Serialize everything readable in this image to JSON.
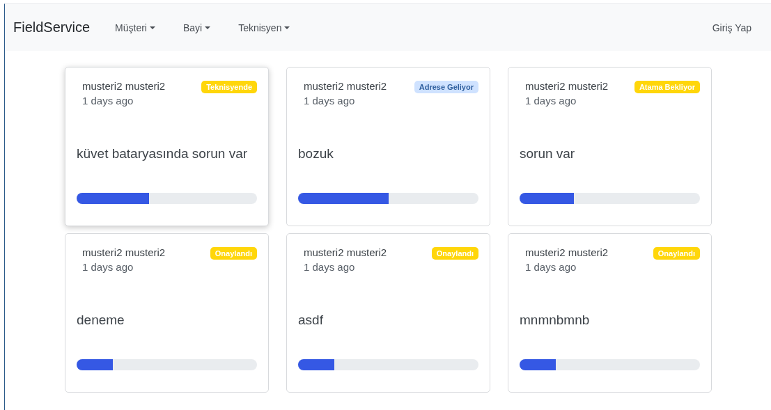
{
  "navbar": {
    "brand": "FieldService",
    "menus": [
      {
        "label": "Müşteri"
      },
      {
        "label": "Bayi"
      },
      {
        "label": "Teknisyen"
      }
    ],
    "login": "Giriş Yap"
  },
  "cards": [
    {
      "customer": "musteri2 musteri2",
      "time": "1 days ago",
      "status": "Teknisyende",
      "color": "#ffd60a",
      "title": "küvet bataryasında sorun var",
      "level": 0.4,
      "highlighted": true
    },
    {
      "customer": "musteri2 musteri2",
      "time": "1 days ago",
      "status": "Adrese Geliyor",
      "color": "#cfe2ff",
      "title": "bozuk",
      "level": 0.5,
      "highlighted": false
    },
    {
      "customer": "musteri2 musteri2",
      "time": "1 days ago",
      "status": "Atama Bekliyor",
      "color": "#ffd60a",
      "title": "sorun var",
      "level": 0.3,
      "highlighted": false
    },
    {
      "customer": "musteri2 musteri2",
      "time": "1 days ago",
      "status": "Onaylandı",
      "color": "#ffd60a",
      "title": "deneme",
      "level": 0.2,
      "highlighted": false
    },
    {
      "customer": "musteri2 musteri2",
      "time": "1 days ago",
      "status": "Onaylandı",
      "color": "#ffd60a",
      "title": "asdf",
      "level": 0.2,
      "highlighted": false
    },
    {
      "customer": "musteri2 musteri2",
      "time": "1 days ago",
      "status": "Onaylandı",
      "color": "#ffd60a",
      "title": "mnmnbmnb",
      "level": 0.2,
      "highlighted": false
    }
  ]
}
